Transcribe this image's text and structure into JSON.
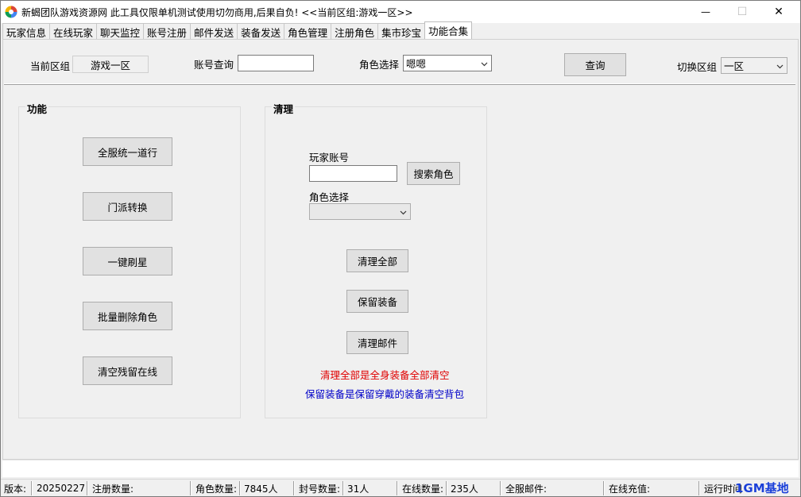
{
  "window": {
    "title": "新蝎团队游戏资源网 此工具仅限单机测试使用切勿商用,后果自负! <<当前区组:游戏一区>>",
    "minimize_glyph": "—",
    "maximize_glyph": "☐",
    "close_glyph": "✕"
  },
  "tabs": [
    {
      "label": "玩家信息"
    },
    {
      "label": "在线玩家"
    },
    {
      "label": "聊天监控"
    },
    {
      "label": "账号注册"
    },
    {
      "label": "邮件发送"
    },
    {
      "label": "装备发送"
    },
    {
      "label": "角色管理"
    },
    {
      "label": "注册角色"
    },
    {
      "label": "集市珍宝"
    },
    {
      "label": "功能合集"
    }
  ],
  "toolbar": {
    "current_zone_label": "当前区组",
    "current_zone_value": "游戏一区",
    "account_query_label": "账号查询",
    "account_query_value": "",
    "role_select_label": "角色选择",
    "role_select_value": "嗯嗯",
    "query_button": "查询",
    "switch_zone_label": "切换区组",
    "switch_zone_value": "一区"
  },
  "function_group": {
    "title": "功能",
    "buttons": [
      "全服统一道行",
      "门派转换",
      "一键刷星",
      "批量删除角色",
      "清空残留在线"
    ]
  },
  "clean_group": {
    "title": "清理",
    "player_account_label": "玩家账号",
    "player_account_value": "",
    "search_role_button": "搜索角色",
    "role_select_label": "角色选择",
    "role_select_value": "",
    "clean_all_button": "清理全部",
    "keep_equipment_button": "保留装备",
    "clean_mail_button": "清理邮件",
    "note_red": "清理全部是全身装备全部清空",
    "note_blue": "保留装备是保留穿戴的装备清空背包"
  },
  "statusbar": {
    "version_label": "版本:",
    "version_value": "20250227",
    "register_count_label": "注册数量:",
    "register_count_value": "",
    "role_count_label": "角色数量:",
    "role_count_value": "7845人",
    "ban_count_label": "封号数量:",
    "ban_count_value": "31人",
    "online_count_label": "在线数量:",
    "online_count_value": "235人",
    "server_mail_label": "全服邮件:",
    "server_mail_value": "",
    "online_recharge_label": "在线充值:",
    "online_recharge_value": "",
    "runtime_label": "运行时间"
  },
  "watermark": "1GM基地",
  "colors": {
    "note_red": "#e00000",
    "note_blue": "#0000c8",
    "watermark": "#1a3fd8"
  }
}
